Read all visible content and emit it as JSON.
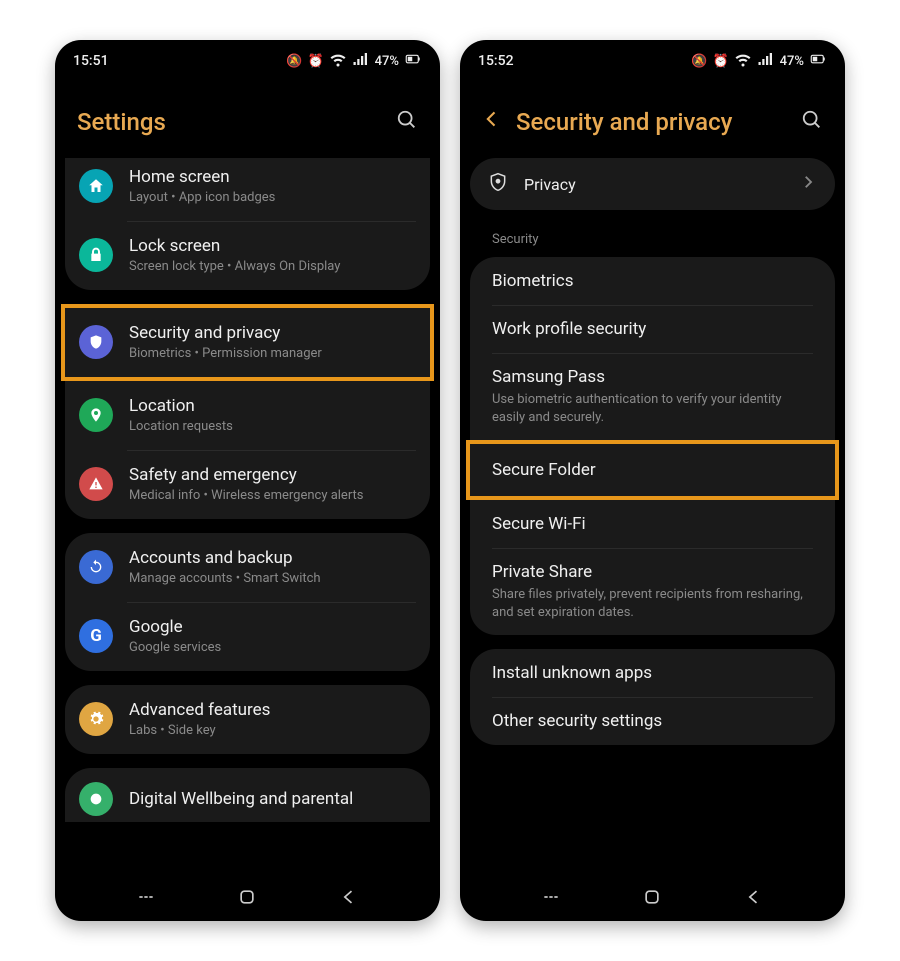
{
  "left": {
    "time": "15:51",
    "battery": "47%",
    "title": "Settings",
    "items": [
      {
        "title": "Home screen",
        "sub": "Layout  •  App icon badges",
        "iconBg": "#07a4b4",
        "icon": "home"
      },
      {
        "title": "Lock screen",
        "sub": "Screen lock type  •  Always On Display",
        "iconBg": "#0bb79a",
        "icon": "lock"
      },
      {
        "title": "Security and privacy",
        "sub": "Biometrics  •  Permission manager",
        "iconBg": "#5b63d6",
        "icon": "shield",
        "highlight": true
      },
      {
        "title": "Location",
        "sub": "Location requests",
        "iconBg": "#1fa858",
        "icon": "pin"
      },
      {
        "title": "Safety and emergency",
        "sub": "Medical info  •  Wireless emergency alerts",
        "iconBg": "#d14b4b",
        "icon": "alert"
      },
      {
        "title": "Accounts and backup",
        "sub": "Manage accounts  •  Smart Switch",
        "iconBg": "#3a6ad4",
        "icon": "sync"
      },
      {
        "title": "Google",
        "sub": "Google services",
        "iconBg": "#2f6fe0",
        "icon": "google"
      },
      {
        "title": "Advanced features",
        "sub": "Labs  •  Side key",
        "iconBg": "#e0a642",
        "icon": "gear"
      },
      {
        "title": "Digital Wellbeing and parental",
        "sub": "",
        "iconBg": "#35b06b",
        "icon": "wellbeing"
      }
    ]
  },
  "right": {
    "time": "15:52",
    "battery": "47%",
    "title": "Security and privacy",
    "privacy": "Privacy",
    "sectionLabel": "Security",
    "rows": [
      {
        "title": "Biometrics"
      },
      {
        "title": "Work profile security"
      },
      {
        "title": "Samsung Pass",
        "sub": "Use biometric authentication to verify your identity easily and securely."
      },
      {
        "title": "Secure Folder",
        "highlight": true
      },
      {
        "title": "Secure Wi-Fi"
      },
      {
        "title": "Private Share",
        "sub": "Share files privately, prevent recipients from resharing, and set expiration dates."
      }
    ],
    "rows2": [
      {
        "title": "Install unknown apps"
      },
      {
        "title": "Other security settings"
      }
    ]
  }
}
